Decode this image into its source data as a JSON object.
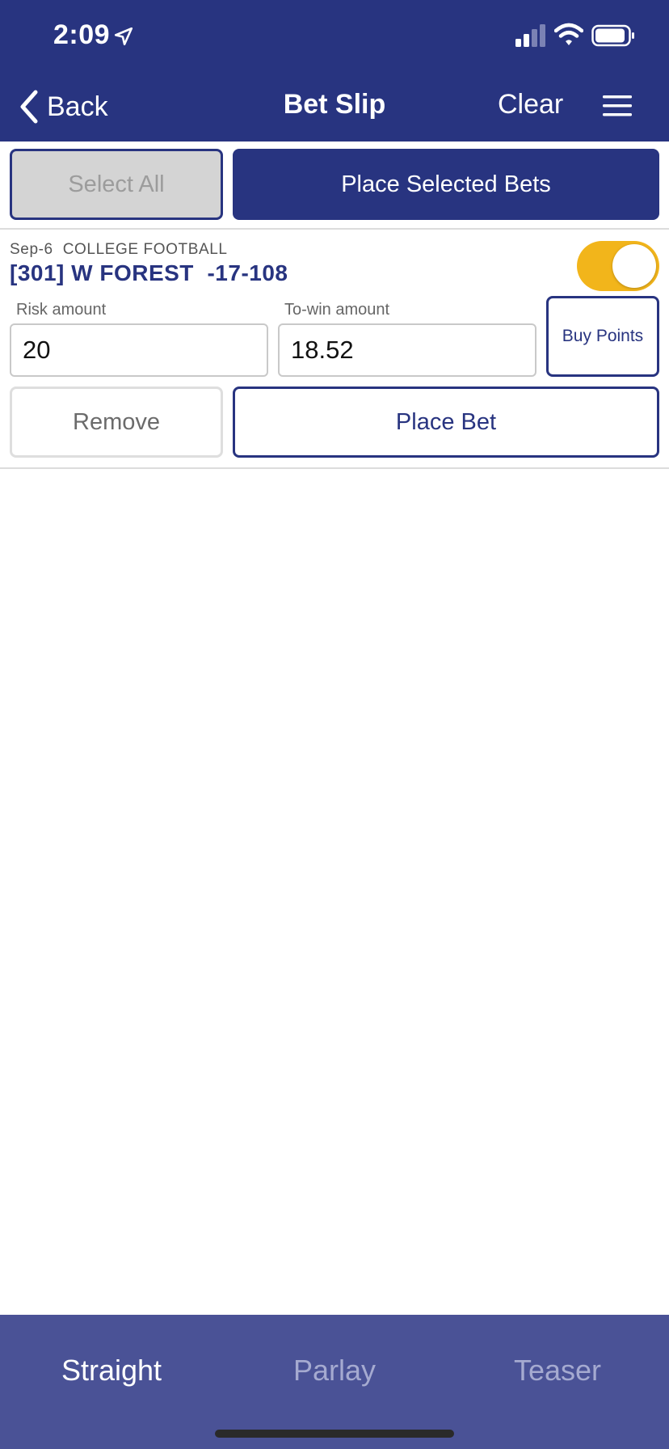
{
  "status_bar": {
    "time": "2:09"
  },
  "nav": {
    "back_label": "Back",
    "title": "Bet Slip",
    "clear_label": "Clear"
  },
  "actions": {
    "select_all_label": "Select All",
    "place_selected_label": "Place Selected Bets"
  },
  "bet": {
    "date": "Sep-6",
    "league": "COLLEGE FOOTBALL",
    "selection": "[301] W FOREST  -17-108",
    "toggle_on": true,
    "risk_label": "Risk amount",
    "risk_value": "20",
    "towin_label": "To-win amount",
    "towin_value": "18.52",
    "buy_points_label": "Buy Points",
    "remove_label": "Remove",
    "place_bet_label": "Place Bet"
  },
  "tabs": [
    {
      "label": "Straight",
      "active": true
    },
    {
      "label": "Parlay",
      "active": false
    },
    {
      "label": "Teaser",
      "active": false
    }
  ],
  "colors": {
    "primary": "#283480",
    "toggle": "#f2b51b",
    "tabbar": "#4a5296"
  }
}
